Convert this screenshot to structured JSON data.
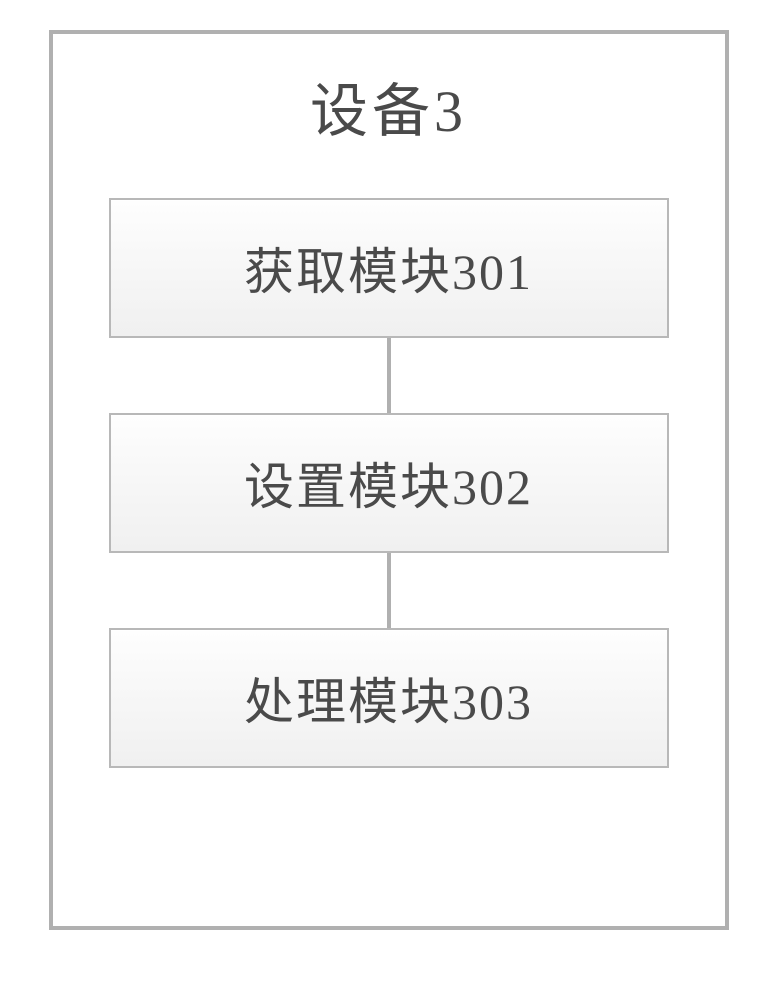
{
  "device": {
    "title": "设备3",
    "modules": [
      {
        "label": "获取模块301"
      },
      {
        "label": "设置模块302"
      },
      {
        "label": "处理模块303"
      }
    ]
  }
}
